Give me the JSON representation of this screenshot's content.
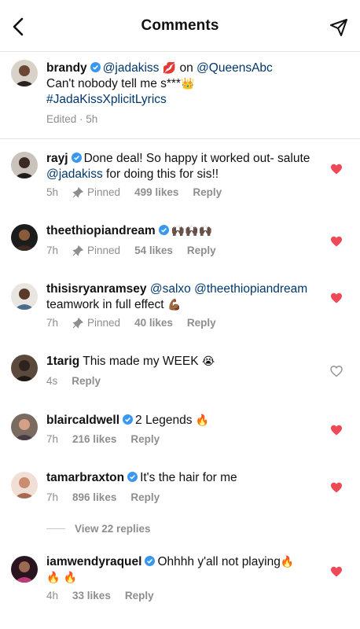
{
  "header": {
    "title": "Comments"
  },
  "caption": {
    "username": "brandy",
    "mention1": "@jadakiss",
    "emoji_kiss": "💋",
    "on_word": "on",
    "mention2": "@QueensAbc",
    "line2": "Can't nobody tell me s***",
    "emoji_crown": "👑",
    "hashtag": "#JadaKissXplicitLyrics",
    "meta": "Edited · 5h"
  },
  "comments": [
    {
      "username": "rayj",
      "text": "Done deal! So happy it worked out- salute",
      "mention": "@jadakiss",
      "text2": "for doing this for sis!!",
      "time": "5h",
      "pinned": "Pinned",
      "likes": "499 likes",
      "reply": "Reply"
    },
    {
      "username": "theethiopiandream",
      "emoji": "🙌🏿🙌🏿🙌🏿",
      "time": "7h",
      "pinned": "Pinned",
      "likes": "54 likes",
      "reply": "Reply"
    },
    {
      "username": "thisisryanramsey",
      "mention": "@salxo",
      "mention2": "@theethiopiandream",
      "text": "teamwork in full effect",
      "emoji": "💪🏾",
      "time": "7h",
      "pinned": "Pinned",
      "likes": "40 likes",
      "reply": "Reply"
    },
    {
      "username": "1tarig",
      "text": "This made my WEEK",
      "emoji": "😭",
      "time": "4s",
      "reply": "Reply"
    },
    {
      "username": "blaircaldwell",
      "text": "2 Legends",
      "emoji": "🔥",
      "time": "7h",
      "likes": "216 likes",
      "reply": "Reply"
    },
    {
      "username": "tamarbraxton",
      "text": "It's the hair for me",
      "time": "7h",
      "likes": "896 likes",
      "reply": "Reply"
    },
    {
      "username": "iamwendyraquel",
      "text": "Ohhhh y'all not playing",
      "emoji": "🔥",
      "emoji2": "🔥 🔥",
      "time": "4h",
      "likes": "33 likes",
      "reply": "Reply"
    }
  ],
  "view_replies": "View 22 replies",
  "colors": {
    "accent_blue": "#0095f6",
    "mention": "#00376b",
    "heart_red": "#ed4956",
    "meta_gray": "#8e8e8e"
  },
  "icons": [
    "back-arrow-icon",
    "send-icon",
    "verified-icon",
    "pin-icon",
    "heart-icon"
  ]
}
